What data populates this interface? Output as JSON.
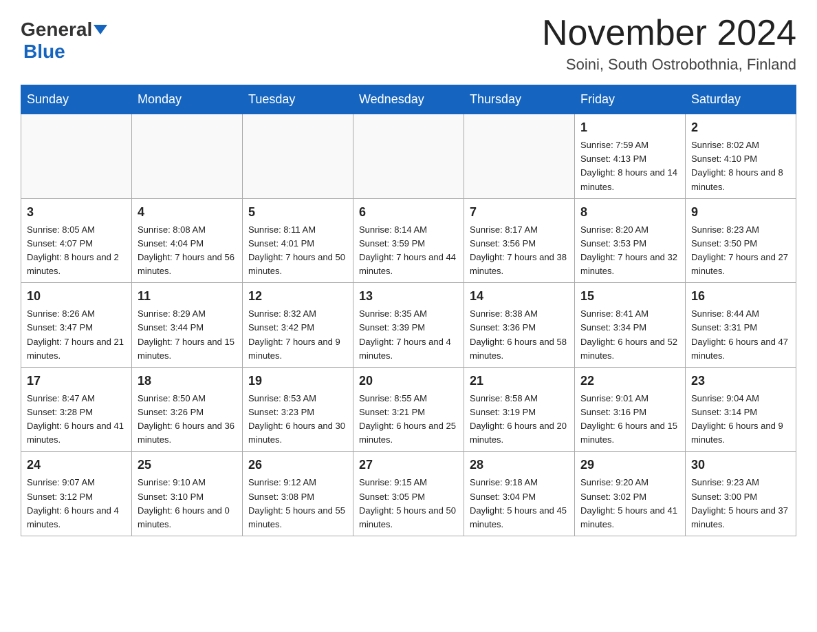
{
  "header": {
    "logo_line1": "General",
    "logo_line2": "Blue",
    "month_title": "November 2024",
    "location": "Soini, South Ostrobothnia, Finland"
  },
  "days_of_week": [
    "Sunday",
    "Monday",
    "Tuesday",
    "Wednesday",
    "Thursday",
    "Friday",
    "Saturday"
  ],
  "weeks": [
    [
      {
        "num": "",
        "info": ""
      },
      {
        "num": "",
        "info": ""
      },
      {
        "num": "",
        "info": ""
      },
      {
        "num": "",
        "info": ""
      },
      {
        "num": "",
        "info": ""
      },
      {
        "num": "1",
        "info": "Sunrise: 7:59 AM\nSunset: 4:13 PM\nDaylight: 8 hours\nand 14 minutes."
      },
      {
        "num": "2",
        "info": "Sunrise: 8:02 AM\nSunset: 4:10 PM\nDaylight: 8 hours\nand 8 minutes."
      }
    ],
    [
      {
        "num": "3",
        "info": "Sunrise: 8:05 AM\nSunset: 4:07 PM\nDaylight: 8 hours\nand 2 minutes."
      },
      {
        "num": "4",
        "info": "Sunrise: 8:08 AM\nSunset: 4:04 PM\nDaylight: 7 hours\nand 56 minutes."
      },
      {
        "num": "5",
        "info": "Sunrise: 8:11 AM\nSunset: 4:01 PM\nDaylight: 7 hours\nand 50 minutes."
      },
      {
        "num": "6",
        "info": "Sunrise: 8:14 AM\nSunset: 3:59 PM\nDaylight: 7 hours\nand 44 minutes."
      },
      {
        "num": "7",
        "info": "Sunrise: 8:17 AM\nSunset: 3:56 PM\nDaylight: 7 hours\nand 38 minutes."
      },
      {
        "num": "8",
        "info": "Sunrise: 8:20 AM\nSunset: 3:53 PM\nDaylight: 7 hours\nand 32 minutes."
      },
      {
        "num": "9",
        "info": "Sunrise: 8:23 AM\nSunset: 3:50 PM\nDaylight: 7 hours\nand 27 minutes."
      }
    ],
    [
      {
        "num": "10",
        "info": "Sunrise: 8:26 AM\nSunset: 3:47 PM\nDaylight: 7 hours\nand 21 minutes."
      },
      {
        "num": "11",
        "info": "Sunrise: 8:29 AM\nSunset: 3:44 PM\nDaylight: 7 hours\nand 15 minutes."
      },
      {
        "num": "12",
        "info": "Sunrise: 8:32 AM\nSunset: 3:42 PM\nDaylight: 7 hours\nand 9 minutes."
      },
      {
        "num": "13",
        "info": "Sunrise: 8:35 AM\nSunset: 3:39 PM\nDaylight: 7 hours\nand 4 minutes."
      },
      {
        "num": "14",
        "info": "Sunrise: 8:38 AM\nSunset: 3:36 PM\nDaylight: 6 hours\nand 58 minutes."
      },
      {
        "num": "15",
        "info": "Sunrise: 8:41 AM\nSunset: 3:34 PM\nDaylight: 6 hours\nand 52 minutes."
      },
      {
        "num": "16",
        "info": "Sunrise: 8:44 AM\nSunset: 3:31 PM\nDaylight: 6 hours\nand 47 minutes."
      }
    ],
    [
      {
        "num": "17",
        "info": "Sunrise: 8:47 AM\nSunset: 3:28 PM\nDaylight: 6 hours\nand 41 minutes."
      },
      {
        "num": "18",
        "info": "Sunrise: 8:50 AM\nSunset: 3:26 PM\nDaylight: 6 hours\nand 36 minutes."
      },
      {
        "num": "19",
        "info": "Sunrise: 8:53 AM\nSunset: 3:23 PM\nDaylight: 6 hours\nand 30 minutes."
      },
      {
        "num": "20",
        "info": "Sunrise: 8:55 AM\nSunset: 3:21 PM\nDaylight: 6 hours\nand 25 minutes."
      },
      {
        "num": "21",
        "info": "Sunrise: 8:58 AM\nSunset: 3:19 PM\nDaylight: 6 hours\nand 20 minutes."
      },
      {
        "num": "22",
        "info": "Sunrise: 9:01 AM\nSunset: 3:16 PM\nDaylight: 6 hours\nand 15 minutes."
      },
      {
        "num": "23",
        "info": "Sunrise: 9:04 AM\nSunset: 3:14 PM\nDaylight: 6 hours\nand 9 minutes."
      }
    ],
    [
      {
        "num": "24",
        "info": "Sunrise: 9:07 AM\nSunset: 3:12 PM\nDaylight: 6 hours\nand 4 minutes."
      },
      {
        "num": "25",
        "info": "Sunrise: 9:10 AM\nSunset: 3:10 PM\nDaylight: 6 hours\nand 0 minutes."
      },
      {
        "num": "26",
        "info": "Sunrise: 9:12 AM\nSunset: 3:08 PM\nDaylight: 5 hours\nand 55 minutes."
      },
      {
        "num": "27",
        "info": "Sunrise: 9:15 AM\nSunset: 3:05 PM\nDaylight: 5 hours\nand 50 minutes."
      },
      {
        "num": "28",
        "info": "Sunrise: 9:18 AM\nSunset: 3:04 PM\nDaylight: 5 hours\nand 45 minutes."
      },
      {
        "num": "29",
        "info": "Sunrise: 9:20 AM\nSunset: 3:02 PM\nDaylight: 5 hours\nand 41 minutes."
      },
      {
        "num": "30",
        "info": "Sunrise: 9:23 AM\nSunset: 3:00 PM\nDaylight: 5 hours\nand 37 minutes."
      }
    ]
  ]
}
